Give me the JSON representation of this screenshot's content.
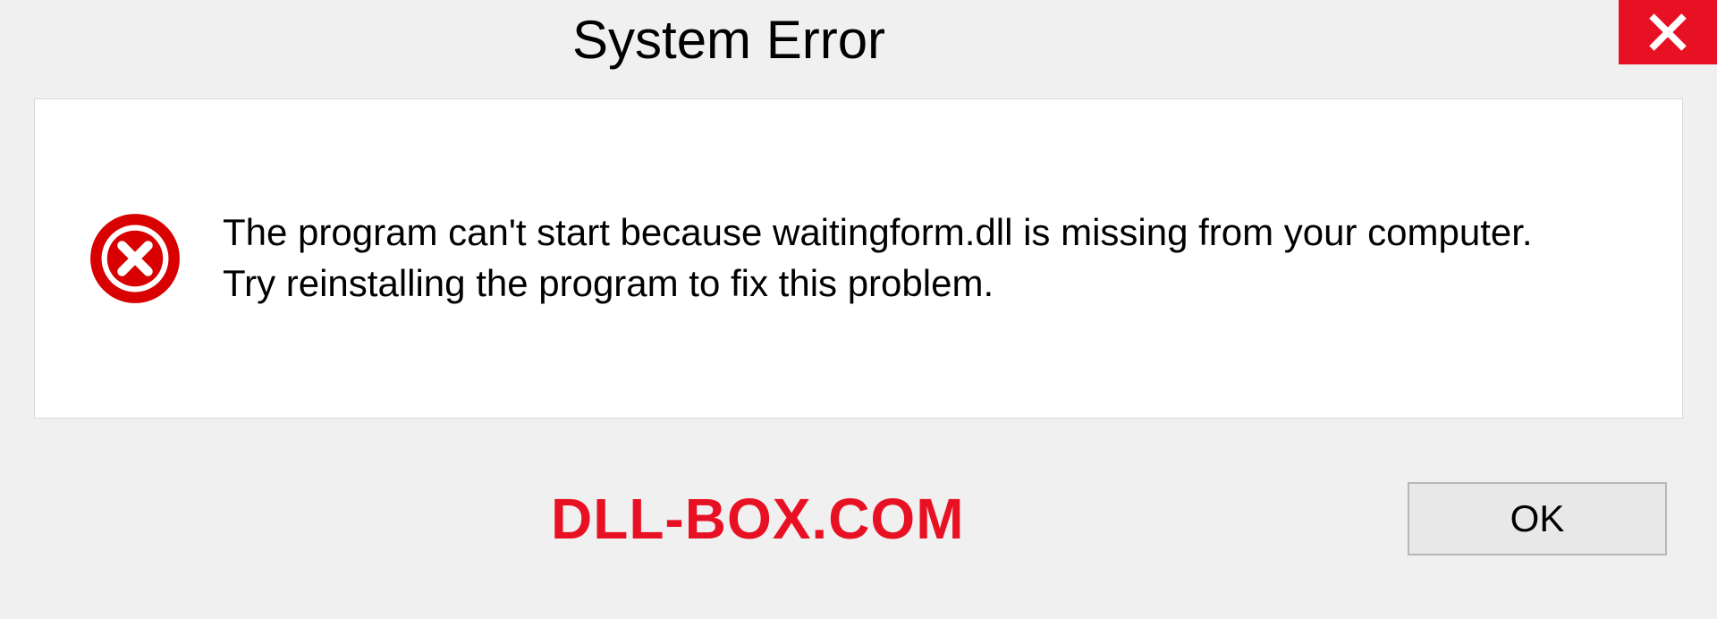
{
  "dialog": {
    "title": "System Error",
    "message": "The program can't start because waitingform.dll is missing from your computer. Try reinstalling the program to fix this problem.",
    "ok_label": "OK"
  },
  "watermark": "DLL-BOX.COM",
  "colors": {
    "accent_red": "#e81123",
    "background": "#f0f0f0",
    "panel": "#ffffff"
  }
}
